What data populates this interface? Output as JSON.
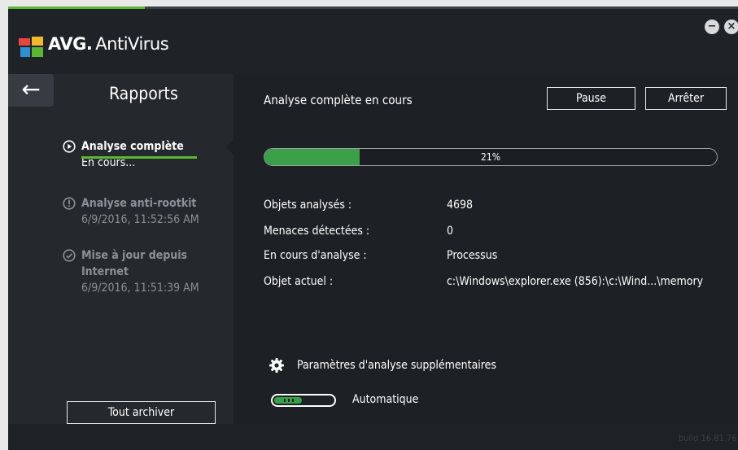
{
  "app": {
    "brand_avg": "AVG.",
    "brand_product": "AntiVirus",
    "minimize_glyph": "−",
    "close_glyph": "×"
  },
  "colors": {
    "accent_green": "#5bb733",
    "progress_green": "#3aa149",
    "window_background": "#1d2024",
    "sidebar_background": "#25282d",
    "dim_text": "#8d9197"
  },
  "sidebar": {
    "back_glyph": "←",
    "title": "Rapports",
    "items": [
      {
        "icon": "play-circle-icon",
        "icon_glyph": "▶",
        "name": "Analyse complète",
        "sub": "En cours...",
        "active": true
      },
      {
        "icon": "alert-circle-icon",
        "icon_glyph": "!",
        "name": "Analyse anti-rootkit",
        "sub": "6/9/2016, 11:52:56 AM",
        "active": false
      },
      {
        "icon": "check-circle-icon",
        "icon_glyph": "✓",
        "name": "Mise à jour depuis",
        "name2": "Internet",
        "sub": "6/9/2016, 11:51:39 AM",
        "active": false
      }
    ],
    "archive_label": "Tout archiver"
  },
  "main": {
    "title": "Analyse complète en cours",
    "pause_label": "Pause",
    "stop_label": "Arrêter",
    "progress_percent": 21,
    "progress_label": "21%",
    "rows": [
      {
        "label": "Objets analysés :",
        "value": "4698"
      },
      {
        "label": "Menaces détectées :",
        "value": "0"
      },
      {
        "label": "En cours d'analyse :",
        "value": "Processus"
      },
      {
        "label": "Objet actuel :",
        "value": "c:\\Windows\\explorer.exe (856):\\c:\\Wind...\\memory"
      }
    ],
    "extra_settings_label": "Paramètres d'analyse supplémentaires",
    "toggle_label": "Automatique",
    "toggle_on": true
  },
  "status": {
    "build": "build 16.81.7639"
  }
}
